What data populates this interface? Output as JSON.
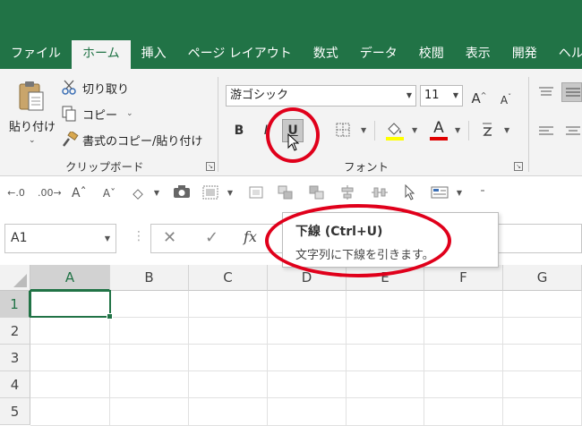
{
  "ribbon_tabs": [
    "ファイル",
    "ホーム",
    "挿入",
    "ページ レイアウト",
    "数式",
    "データ",
    "校閲",
    "表示",
    "開発",
    "ヘルプ"
  ],
  "clipboard": {
    "paste_label": "貼り付け",
    "cut_label": "切り取り",
    "copy_label": "コピー",
    "format_painter_label": "書式のコピー/貼り付け",
    "group_label": "クリップボード"
  },
  "font": {
    "font_name": "游ゴシック",
    "font_size": "11",
    "bold_label": "B",
    "italic_label": "I",
    "underline_label": "U",
    "grow_label": "A",
    "shrink_label": "A",
    "font_color_label": "A",
    "group_label": "フォント"
  },
  "formula_bar": {
    "name_box": "A1",
    "fx_label": "fx",
    "cancel_label": "✕",
    "enter_label": "✓"
  },
  "grid": {
    "columns": [
      "A",
      "B",
      "C",
      "D",
      "E",
      "F",
      "G"
    ],
    "rows": [
      "1",
      "2",
      "3",
      "4",
      "5"
    ]
  },
  "tooltip": {
    "title": "下線 (Ctrl+U)",
    "description": "文字列に下線を引きます。"
  },
  "colors": {
    "accent": "#217346",
    "annotation": "#e0001b",
    "font_color_bar": "#e00000",
    "fill_color_bar": "#ffff00"
  }
}
